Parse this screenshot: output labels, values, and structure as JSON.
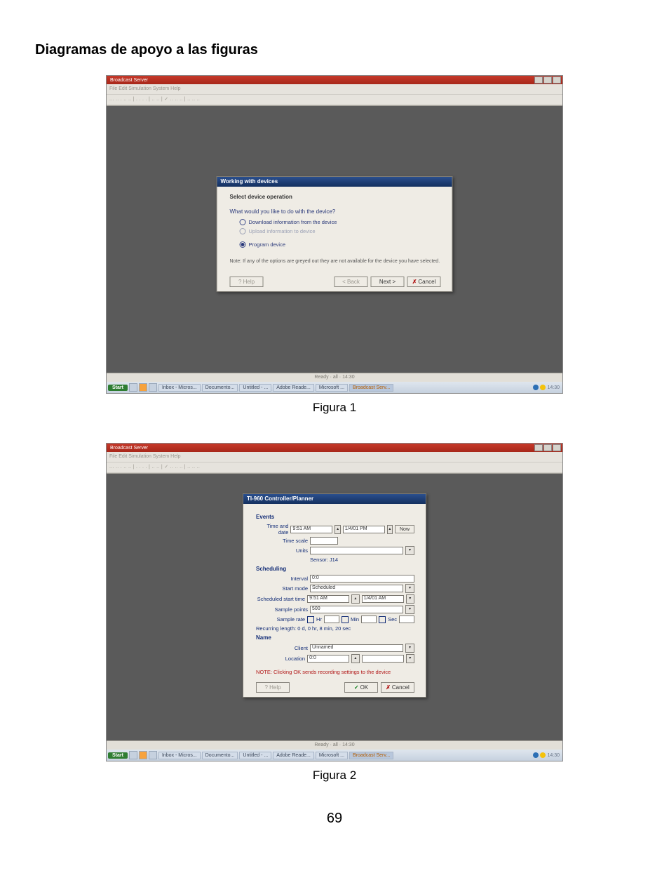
{
  "page": {
    "title": "Diagramas de apoyo a las figuras",
    "caption1": "Figura 1",
    "caption2": "Figura 2",
    "page_number": "69"
  },
  "app": {
    "title": "Broadcast Server",
    "menubar": "File  Edit  Simulation  System  Help",
    "toolbar_text": "... .. . .. .. | . . . . | .. .. | ✓ .. .. .. | .. .. ..",
    "status": "Ready · all · 14:30",
    "taskbar": {
      "start": "Start",
      "tasks": [
        "Inbox - Micros...",
        "Documento...",
        "Untitled - ...",
        "Adobe Reade...",
        "Microsoft ...",
        "Broadcast Serv..."
      ],
      "clock": "14:30"
    }
  },
  "dialog1": {
    "title": "Working with devices",
    "heading": "Select device operation",
    "question": "What would you like to do with the device?",
    "opt1": "Download information from the device",
    "opt2": "Upload information to device",
    "opt3": "Program device",
    "note": "Note: If any of the options are greyed out they are not available for the device you have selected.",
    "btn_help": "? Help",
    "btn_back": "< Back",
    "btn_next": "Next >",
    "btn_cancel": "Cancel"
  },
  "dialog2": {
    "title": "TI-960 Controller/Planner",
    "sec_events": "Events",
    "lbl_time_date": "Time and date",
    "val_time": "9:51 AM",
    "val_date": "1/4/01 PM",
    "btn_now": "Now",
    "lbl_time_scale": "Time scale",
    "lbl_units": "Units",
    "val_units": "",
    "lbl_sensor": "Sensor: J14",
    "sec_scheduling": "Scheduling",
    "lbl_interval": "Interval",
    "val_interval": "0:0",
    "lbl_start_mode": "Start mode",
    "val_start_mode": "Scheduled",
    "lbl_sched_start": "Scheduled start time",
    "val_sched_time": "9:51 AM",
    "val_sched_date": "1/4/01 AM",
    "lbl_sample_points": "Sample points",
    "val_sample_points": "500",
    "lbl_sample_rate": "Sample rate",
    "chk_hr": "Hr",
    "chk_min": "Min",
    "chk_sec": "Sec",
    "recur_note": "Recurring length: 0 d, 0 hr, 8 min, 20 sec",
    "sec_name": "Name",
    "lbl_client": "Client",
    "val_client": "Unnamed",
    "lbl_location": "Location",
    "val_location": "0:0",
    "warn": "NOTE: Clicking OK sends recording settings to the device",
    "btn_help": "? Help",
    "btn_ok": "OK",
    "btn_cancel": "Cancel"
  }
}
